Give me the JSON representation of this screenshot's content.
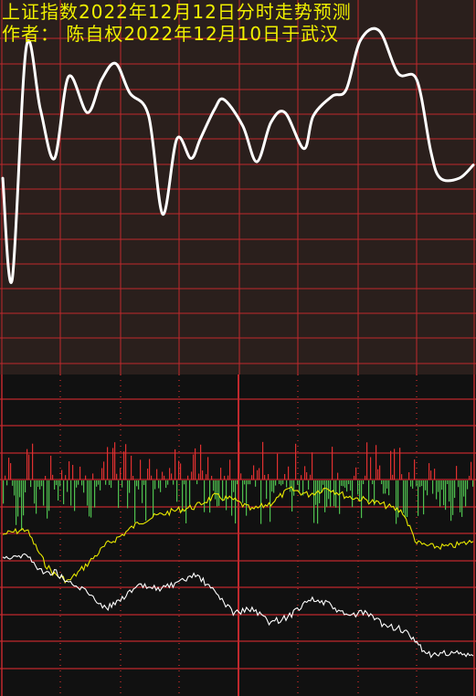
{
  "title": "上证指数2022年12月12日分时走势预测",
  "author_line": "作者： 陈自权2022年12月10日于武汉",
  "colors": {
    "background_top": "#2a1f1c",
    "background_bottom": "#111111",
    "grid": "#c0282d",
    "grid_dotted": "#b02828",
    "title_text": "#f0f000",
    "forecast_line": "#ffffff",
    "volume_up": "#e03030",
    "volume_down": "#4fc04f",
    "yellow_line": "#e8e800",
    "white_line": "#ffffff"
  },
  "chart_data": {
    "type": "line",
    "panels": [
      {
        "name": "price_forecast",
        "y_tick_labels": "none",
        "x_tick_labels": "none",
        "grid": true,
        "series": [
          {
            "color": "#ffffff",
            "x": [
              0,
              0.02,
              0.05,
              0.08,
              0.11,
              0.14,
              0.18,
              0.21,
              0.24,
              0.27,
              0.31,
              0.34,
              0.37,
              0.4,
              0.42,
              0.45,
              0.47,
              0.51,
              0.54,
              0.57,
              0.6,
              0.64,
              0.66,
              0.7,
              0.73,
              0.76,
              0.8,
              0.84,
              0.88,
              0.91,
              0.93,
              0.97,
              1.0
            ],
            "y": [
              0.39,
              0.08,
              0.79,
              0.6,
              0.45,
              0.7,
              0.59,
              0.69,
              0.74,
              0.65,
              0.58,
              0.28,
              0.51,
              0.45,
              0.51,
              0.6,
              0.63,
              0.55,
              0.44,
              0.56,
              0.59,
              0.48,
              0.58,
              0.64,
              0.66,
              0.81,
              0.84,
              0.71,
              0.69,
              0.47,
              0.39,
              0.39,
              0.43
            ]
          }
        ]
      },
      {
        "name": "intraday_lines",
        "y_tick_labels": "none",
        "x_tick_labels": "none",
        "grid": true,
        "series": [
          {
            "color": "#e8e800",
            "x": [
              0,
              0.05,
              0.09,
              0.11,
              0.14,
              0.18,
              0.22,
              0.25,
              0.29,
              0.33,
              0.37,
              0.41,
              0.45,
              0.49,
              0.53,
              0.57,
              0.61,
              0.65,
              0.69,
              0.73,
              0.77,
              0.81,
              0.85,
              0.88,
              0.91,
              0.95,
              1.0
            ],
            "y": [
              0.71,
              0.74,
              0.54,
              0.48,
              0.44,
              0.54,
              0.65,
              0.7,
              0.78,
              0.82,
              0.85,
              0.87,
              0.93,
              0.91,
              0.85,
              0.89,
              0.97,
              0.94,
              0.98,
              0.93,
              0.91,
              0.88,
              0.84,
              0.66,
              0.64,
              0.64,
              0.67
            ]
          },
          {
            "color": "#ffffff",
            "x": [
              0,
              0.05,
              0.09,
              0.11,
              0.14,
              0.18,
              0.22,
              0.25,
              0.29,
              0.33,
              0.37,
              0.41,
              0.45,
              0.49,
              0.53,
              0.57,
              0.61,
              0.65,
              0.69,
              0.73,
              0.77,
              0.81,
              0.85,
              0.88,
              0.91,
              0.95,
              1.0
            ],
            "y": [
              0.58,
              0.59,
              0.48,
              0.5,
              0.43,
              0.38,
              0.28,
              0.34,
              0.41,
              0.4,
              0.42,
              0.48,
              0.38,
              0.26,
              0.28,
              0.2,
              0.24,
              0.34,
              0.31,
              0.24,
              0.26,
              0.19,
              0.16,
              0.08,
              0.01,
              0.03,
              0.01
            ]
          }
        ]
      }
    ]
  }
}
